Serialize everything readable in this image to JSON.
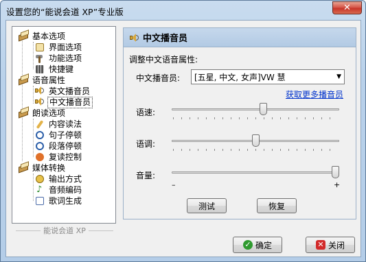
{
  "window": {
    "title": "设置您的“能说会道 XP”专业版",
    "close_glyph": "✕"
  },
  "tree": {
    "groups": [
      {
        "label": "基本选项",
        "icon": "book-icon",
        "items": [
          {
            "label": "界面选项",
            "icon": "page-icon"
          },
          {
            "label": "功能选项",
            "icon": "hammer-icon"
          },
          {
            "label": "快捷键",
            "icon": "keyboard-icon"
          }
        ]
      },
      {
        "label": "语音属性",
        "icon": "book-icon",
        "items": [
          {
            "label": "英文播音员",
            "icon": "speaker-icon"
          },
          {
            "label": "中文播音员",
            "icon": "speaker-icon",
            "selected": true
          }
        ]
      },
      {
        "label": "朗读选项",
        "icon": "book-icon",
        "items": [
          {
            "label": "内容读法",
            "icon": "pencil-icon"
          },
          {
            "label": "句子停顿",
            "icon": "stopwatch-icon"
          },
          {
            "label": "段落停顿",
            "icon": "stopwatch-icon"
          },
          {
            "label": "复读控制",
            "icon": "repeat-icon"
          }
        ]
      },
      {
        "label": "媒体转换",
        "icon": "book-icon",
        "items": [
          {
            "label": "输出方式",
            "icon": "export-icon"
          },
          {
            "label": "音频编码",
            "icon": "music-note-icon"
          },
          {
            "label": "歌词生成",
            "icon": "lyrics-icon"
          }
        ]
      }
    ],
    "footer": "能说会道 XP"
  },
  "panel": {
    "header": "中文播音员",
    "group_title": "调整中文语音属性:",
    "announcer_label": "中文播音员:",
    "announcer_value": "[五星, 中文, 女声]VW 慧",
    "more_link": "获取更多播音员",
    "speed_label": "语速:",
    "speed_level": 0.55,
    "pitch_label": "语调:",
    "pitch_level": 0.5,
    "volume_label": "音量:",
    "volume_level": 1.0,
    "minus": "–",
    "plus": "+",
    "test_button": "测试",
    "restore_button": "恢复"
  },
  "footer_buttons": {
    "ok": "确定",
    "close": "关闭"
  },
  "colors": {
    "link": "#0033cc",
    "ok_check": "#2e9a2e",
    "close_x": "#d22a2a"
  }
}
